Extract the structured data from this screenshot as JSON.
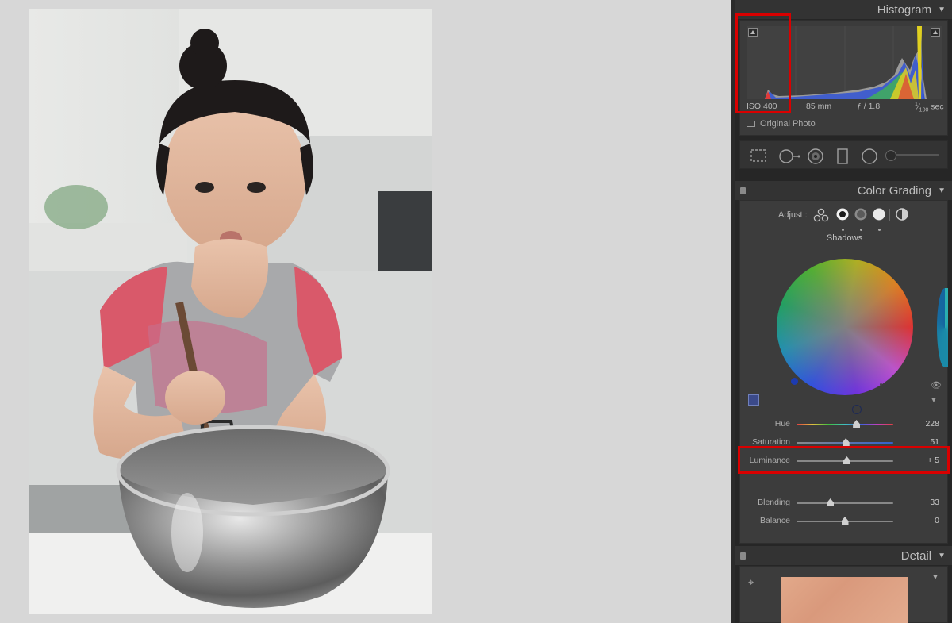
{
  "panels": {
    "histogram": {
      "title": "Histogram",
      "iso": "ISO 400",
      "focal": "85 mm",
      "aperture": "ƒ / 1.8",
      "shutter_num": "1",
      "shutter_den": "100",
      "shutter_unit": "sec",
      "original_photo": "Original Photo"
    },
    "color_grading": {
      "title": "Color Grading",
      "adjust_label": "Adjust :",
      "mode_label": "Shadows",
      "sliders": {
        "hue": {
          "label": "Hue",
          "value": "228",
          "fraction": 0.62
        },
        "saturation": {
          "label": "Saturation",
          "value": "51",
          "fraction": 0.51
        },
        "luminance": {
          "label": "Luminance",
          "value": "+ 5",
          "fraction": 0.52
        },
        "blending": {
          "label": "Blending",
          "value": "33",
          "fraction": 0.35
        },
        "balance": {
          "label": "Balance",
          "value": "0",
          "fraction": 0.5
        }
      }
    },
    "detail": {
      "title": "Detail"
    }
  },
  "colors": {
    "highlight": "#d90000",
    "panel_bg": "#262626",
    "canvas_bg": "#d7d7d7"
  }
}
